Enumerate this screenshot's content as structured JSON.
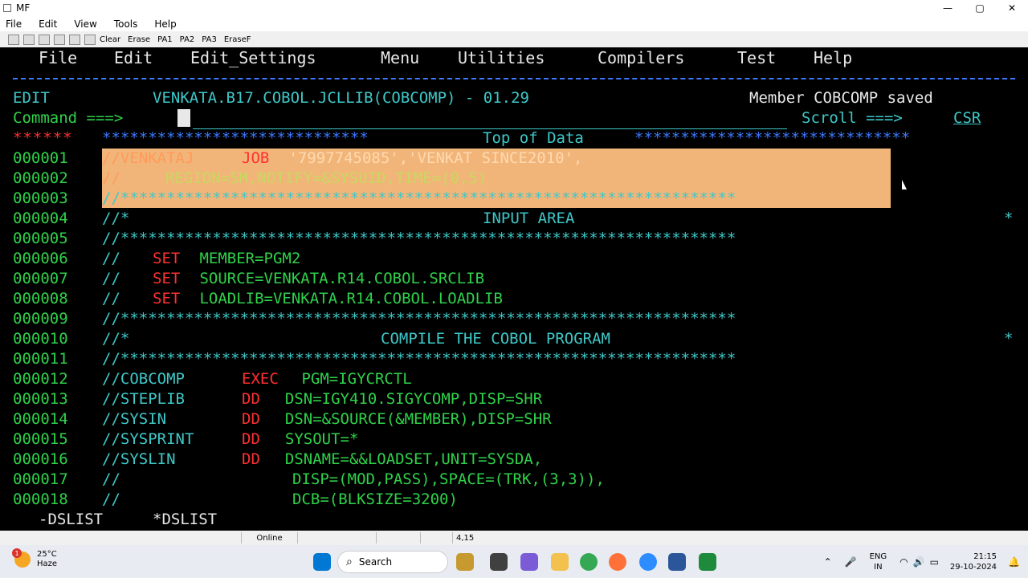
{
  "window": {
    "title": "MF",
    "controls": {
      "minimize": "—",
      "maximize": "▢",
      "close": "✕"
    }
  },
  "menubar": {
    "items": [
      "File",
      "Edit",
      "View",
      "Tools",
      "Help"
    ]
  },
  "toolbar": {
    "buttons": [
      "Clear",
      "Erase",
      "PA1",
      "PA2",
      "PA3",
      "EraseF"
    ]
  },
  "ispf": {
    "menu": [
      "File",
      "Edit",
      "Edit_Settings",
      "Menu",
      "Utilities",
      "Compilers",
      "Test",
      "Help"
    ],
    "mode": "EDIT",
    "dataset": "VENKATA.B17.COBOL.JCLLIB(COBCOMP) - 01.29",
    "message": "Member COBCOMP saved",
    "command_label": "Command ===>",
    "command_value": "",
    "scroll_label": "Scroll ===>",
    "scroll_value": "CSR",
    "top_marker": "******",
    "top_stars_left": "*****************************",
    "top_of_data": "Top of Data",
    "top_stars_right": "******************************",
    "lines": [
      {
        "num": "000001",
        "a": "//VENKATAJ ",
        "kw": "JOB",
        "b": " '7997745085','VENKAT SINCE2010',"
      },
      {
        "num": "000002",
        "a": "//   ",
        "kw": "",
        "b": "REGION=5M,NOTIFY=&SYSUID,TIME=(0,5)"
      },
      {
        "num": "000003",
        "a": "//*******************************************************************",
        "kw": "",
        "b": ""
      },
      {
        "num": "000004",
        "a": "//*",
        "kw": "",
        "b": "INPUT AREA"
      },
      {
        "num": "000005",
        "a": "//*******************************************************************",
        "kw": "",
        "b": ""
      },
      {
        "num": "000006",
        "a": "//  ",
        "kw": "SET",
        "b": " MEMBER=PGM2"
      },
      {
        "num": "000007",
        "a": "//  ",
        "kw": "SET",
        "b": " SOURCE=VENKATA.R14.COBOL.SRCLIB"
      },
      {
        "num": "000008",
        "a": "//  ",
        "kw": "SET",
        "b": " LOADLIB=VENKATA.R14.COBOL.LOADLIB"
      },
      {
        "num": "000009",
        "a": "//*******************************************************************",
        "kw": "",
        "b": ""
      },
      {
        "num": "000010",
        "a": "//*",
        "kw": "",
        "b": "COMPILE THE COBOL PROGRAM"
      },
      {
        "num": "000011",
        "a": "//*******************************************************************",
        "kw": "",
        "b": ""
      },
      {
        "num": "000012",
        "a": "//COBCOMP  ",
        "kw": "EXEC",
        "b": " PGM=IGYCRCTL"
      },
      {
        "num": "000013",
        "a": "//STEPLIB  ",
        "kw": "DD",
        "b": "  DSN=IGY410.SIGYCOMP,DISP=SHR"
      },
      {
        "num": "000014",
        "a": "//SYSIN    ",
        "kw": "DD",
        "b": "  DSN=&SOURCE(&MEMBER),DISP=SHR"
      },
      {
        "num": "000015",
        "a": "//SYSPRINT ",
        "kw": "DD",
        "b": "  SYSOUT=*"
      },
      {
        "num": "000016",
        "a": "//SYSLIN   ",
        "kw": "DD",
        "b": "  DSNAME=&&LOADSET,UNIT=SYSDA,"
      },
      {
        "num": "000017",
        "a": "//",
        "kw": "",
        "b": "DISP=(MOD,PASS),SPACE=(TRK,(3,3)),"
      },
      {
        "num": "000018",
        "a": "//",
        "kw": "",
        "b": "DCB=(BLKSIZE=3200)"
      }
    ],
    "trailing_star": "*",
    "function_keys": [
      "-DSLIST",
      "*DSLIST"
    ]
  },
  "statusbar": {
    "connection": "Online",
    "cursor": "4,15"
  },
  "taskbar": {
    "weather_temp": "25°C",
    "weather_desc": "Haze",
    "weather_badge": "1",
    "search_placeholder": "Search",
    "lang": "ENG",
    "region": "IN",
    "time": "21:15",
    "date": "29-10-2024"
  }
}
